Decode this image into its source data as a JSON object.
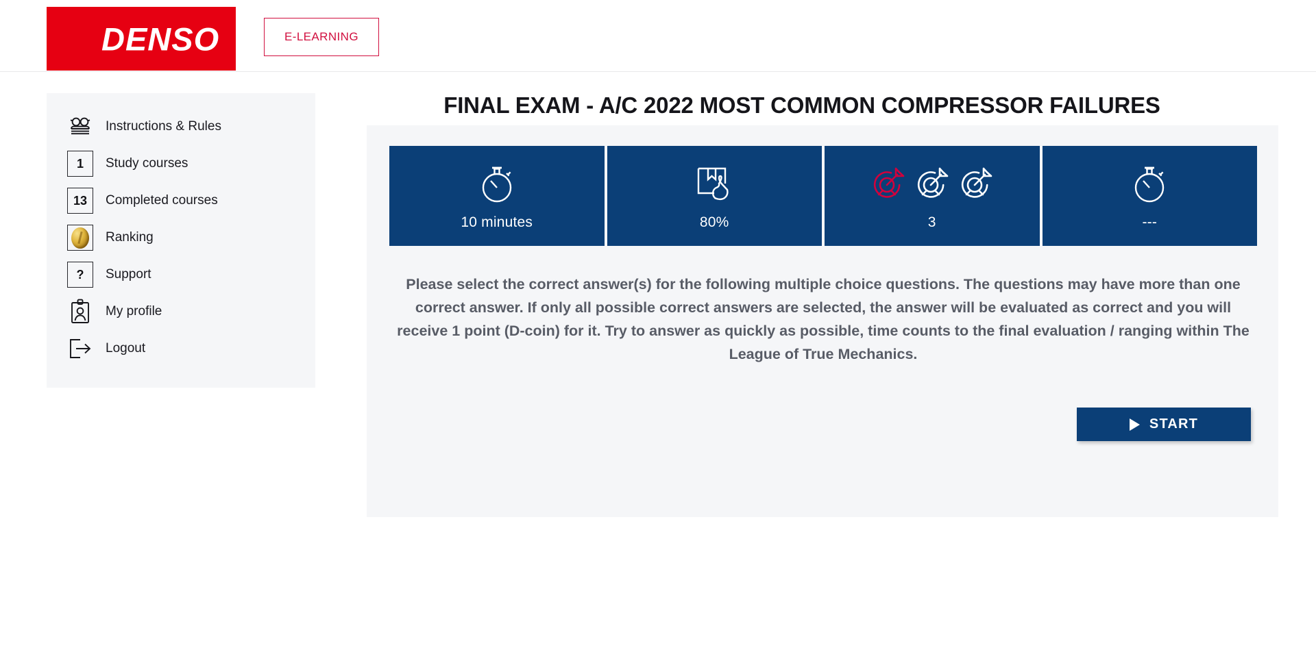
{
  "header": {
    "logo_text": "DENSO",
    "logo_color": "#e60012",
    "elearning_label": "E-LEARNING",
    "elearning_color": "#d10f3f"
  },
  "sidebar": {
    "items": [
      {
        "label": "Instructions & Rules",
        "icon": "glasses-book-icon",
        "badge": ""
      },
      {
        "label": "Study courses",
        "icon": "count-box-icon",
        "badge": "1"
      },
      {
        "label": "Completed courses",
        "icon": "count-box-icon",
        "badge": "13"
      },
      {
        "label": "Ranking",
        "icon": "coin-icon",
        "badge": ""
      },
      {
        "label": "Support",
        "icon": "question-box-icon",
        "badge": "?"
      },
      {
        "label": "My profile",
        "icon": "id-badge-icon",
        "badge": ""
      },
      {
        "label": "Logout",
        "icon": "logout-arrow-icon",
        "badge": ""
      }
    ]
  },
  "main": {
    "title": "FINAL EXAM - A/C 2022 MOST COMMON COMPRESSOR FAILURES",
    "accent_blue": "#0b3f77",
    "accent_red": "#d1023c",
    "cards": [
      {
        "icon": "stopwatch-icon",
        "value": "10 minutes"
      },
      {
        "icon": "book-thumbsup-icon",
        "value": "80%"
      },
      {
        "icon": "target-arrow-icon",
        "value": "3"
      },
      {
        "icon": "stopwatch-icon",
        "value": "---"
      }
    ],
    "description": "Please select the correct answer(s) for the following multiple choice questions. The questions may have more than one correct answer. If only all possible correct answers are selected, the answer will be evaluated as correct and you will receive 1 point (D-coin) for it. Try to answer as quickly as possible, time counts to the final evaluation / ranging within The League of True Mechanics.",
    "start_label": "START"
  }
}
